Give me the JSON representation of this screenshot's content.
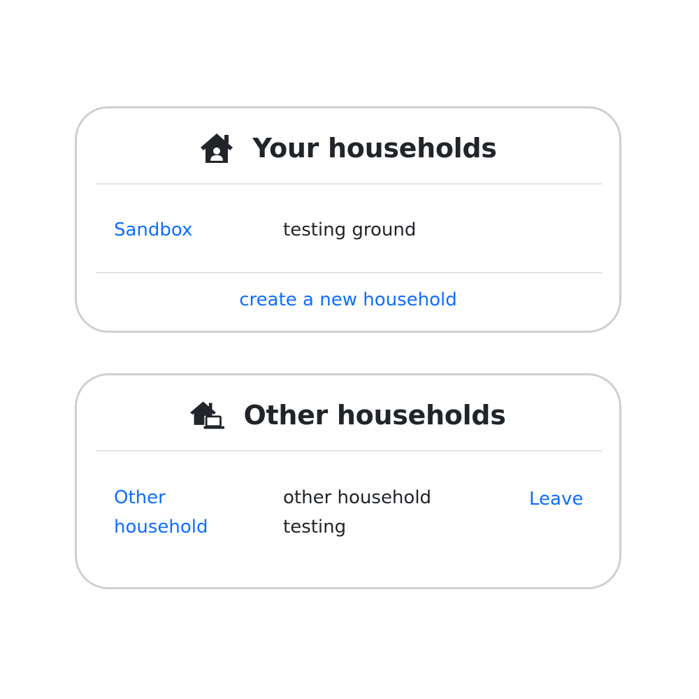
{
  "your_households": {
    "icon": "house-user-icon",
    "title": "Your households",
    "rows": [
      {
        "name": "Sandbox",
        "description": "testing ground"
      }
    ],
    "create_label": "create a new household"
  },
  "other_households": {
    "icon": "house-laptop-icon",
    "title": "Other households",
    "rows": [
      {
        "name": "Other household",
        "description": "other household testing",
        "action": "Leave"
      }
    ]
  },
  "colors": {
    "link": "#0d6efd",
    "text": "#212529",
    "border": "#cfcfcf",
    "divider": "#e3e3e3"
  }
}
